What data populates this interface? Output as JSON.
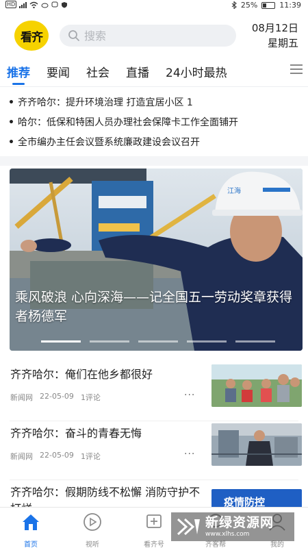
{
  "status_bar": {
    "hd": "HD",
    "battery": "25%",
    "time": "11:39"
  },
  "header": {
    "logo_text": "看齐",
    "search_placeholder": "搜索",
    "date": "08月12日",
    "weekday": "星期五"
  },
  "tabs": [
    {
      "label": "推荐",
      "active": true
    },
    {
      "label": "要闻"
    },
    {
      "label": "社会"
    },
    {
      "label": "直播"
    },
    {
      "label": "24小时最热"
    }
  ],
  "headlines": [
    "齐齐哈尔：提升环境治理 打造宜居小区 1",
    "哈尔：低保和特困人员办理社会保障卡工作全面铺开",
    "全市编办主任会议暨系统廉政建设会议召开"
  ],
  "banner": {
    "title": "乘风破浪 心向深海——记全国五一劳动奖章获得者杨德军",
    "helmet_text": "江海",
    "slides": 5,
    "active_slide": 0
  },
  "news": [
    {
      "title": "齐齐哈尔：俺们在他乡都很好",
      "source": "新闻网",
      "date": "22-05-09",
      "comments": "1评论",
      "more": "···"
    },
    {
      "title": "齐齐哈尔：奋斗的青春无悔",
      "source": "新闻网",
      "date": "22-05-09",
      "comments": "1评论",
      "more": "···"
    },
    {
      "title": "齐齐哈尔：假期防线不松懈 消防守护不打烊",
      "thumb_text": "疫情防控"
    }
  ],
  "bottom_nav": [
    {
      "label": "首页",
      "icon": "home-icon",
      "active": true
    },
    {
      "label": "视听",
      "icon": "play-icon"
    },
    {
      "label": "看齐号",
      "icon": "add-icon"
    },
    {
      "label": "齐客帮",
      "icon": "help-icon"
    },
    {
      "label": "我的",
      "icon": "user-icon"
    }
  ],
  "watermark": {
    "title": "新绿资源网",
    "url": "www.xlhs.com"
  },
  "colors": {
    "accent": "#1a73e8",
    "logo_bg": "#f6d200"
  }
}
